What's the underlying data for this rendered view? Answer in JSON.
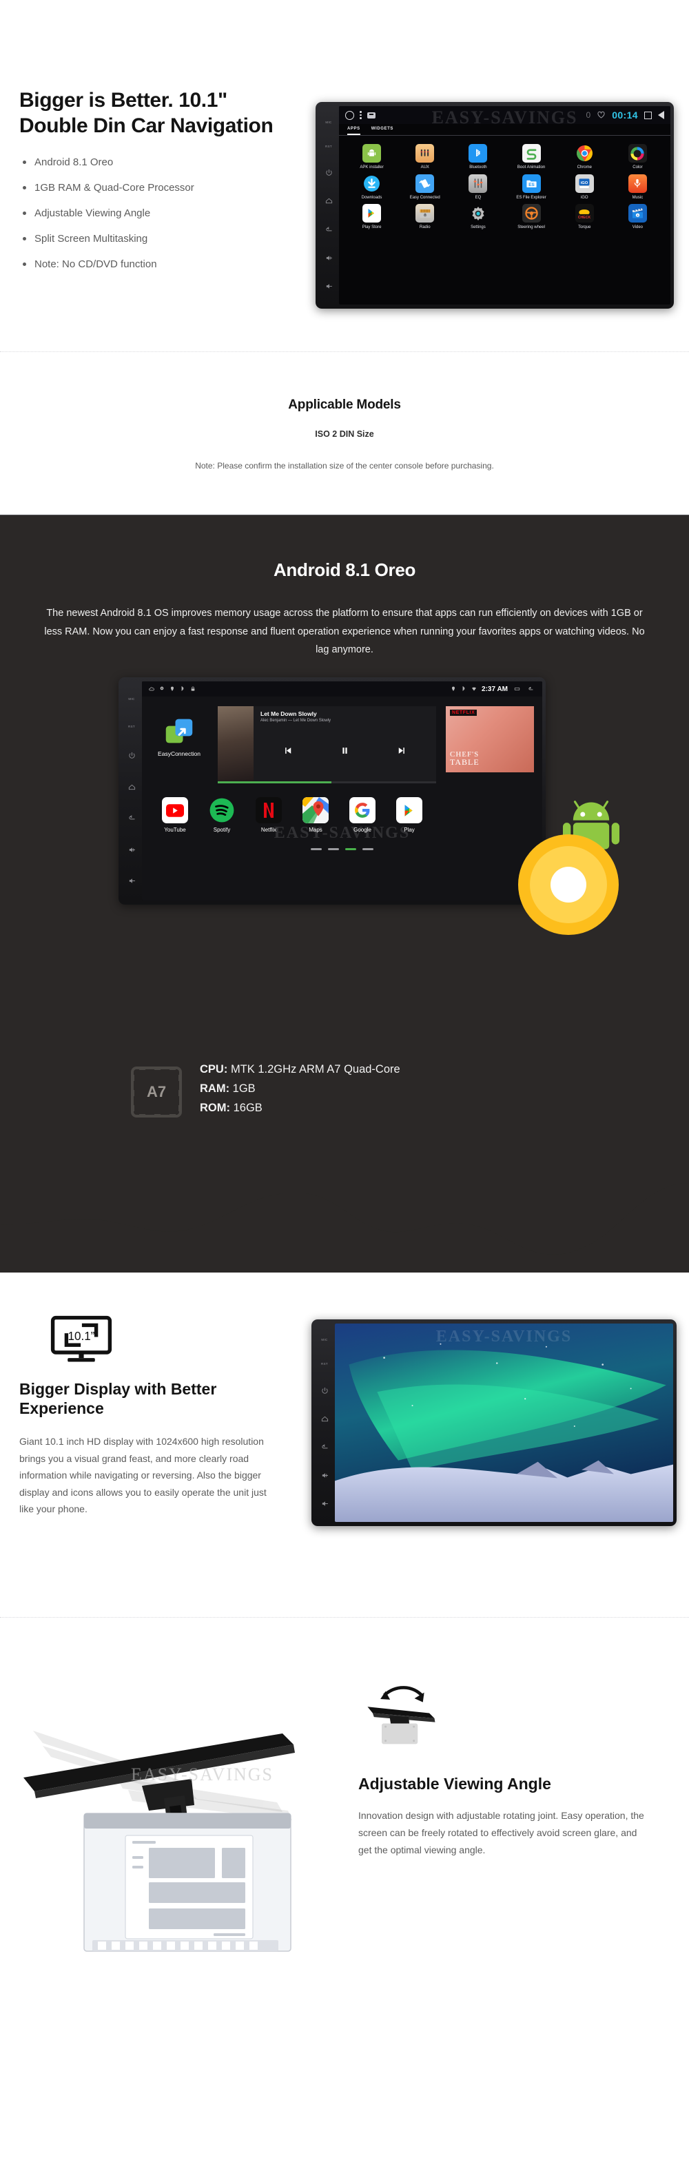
{
  "hero": {
    "title_line1": "Bigger is Better. 10.1\"",
    "title_line2": "Double Din Car Navigation",
    "features": [
      "Android 8.1 Oreo",
      "1GB RAM & Quad-Core Processor",
      "Adjustable Viewing Angle",
      "Split Screen Multitasking",
      "Note: No CD/DVD function"
    ],
    "device": {
      "watermark": "EASY-SAVINGS",
      "rail": [
        "MIC",
        "RST"
      ],
      "statusbar": {
        "badge_count": "0",
        "clock": "00:14"
      },
      "tabs": [
        {
          "label": "APPS",
          "active": true
        },
        {
          "label": "WIDGETS",
          "active": false
        }
      ],
      "apps": [
        {
          "label": "APK installer",
          "icon": "android-robot-icon"
        },
        {
          "label": "AUX",
          "icon": "aux-jacks-icon"
        },
        {
          "label": "Bluetooth",
          "icon": "bluetooth-icon"
        },
        {
          "label": "Boot Animation",
          "icon": "boot-animation-icon"
        },
        {
          "label": "Chrome",
          "icon": "chrome-icon"
        },
        {
          "label": "Color",
          "icon": "color-wheel-icon"
        },
        {
          "label": "Downloads",
          "icon": "download-arrow-icon"
        },
        {
          "label": "Easy Connected",
          "icon": "easy-connected-icon"
        },
        {
          "label": "EQ",
          "icon": "equalizer-icon"
        },
        {
          "label": "ES File Explorer",
          "icon": "es-file-explorer-icon"
        },
        {
          "label": "iGO",
          "icon": "igo-navigation-icon"
        },
        {
          "label": "Music",
          "icon": "music-mic-icon"
        },
        {
          "label": "Play Store",
          "icon": "play-store-icon"
        },
        {
          "label": "Radio",
          "icon": "radio-icon"
        },
        {
          "label": "Settings",
          "icon": "gear-icon"
        },
        {
          "label": "Steering wheel",
          "icon": "steering-wheel-icon"
        },
        {
          "label": "Torque",
          "icon": "torque-obd-icon"
        },
        {
          "label": "Video",
          "icon": "video-clapper-icon"
        }
      ]
    }
  },
  "models": {
    "heading": "Applicable Models",
    "subheading": "ISO 2 DIN Size",
    "note": "Note: Please confirm the installation size of the center console before purchasing."
  },
  "android": {
    "heading": "Android 8.1 Oreo",
    "body": "The newest Android 8.1 OS improves memory usage across the platform to ensure that apps can run efficiently on devices with 1GB or less RAM. Now you can enjoy a fast response and fluent operation experience when running your favorites apps or watching videos. No lag anymore.",
    "home": {
      "watermark": "EASY-SAVINGS",
      "statusbar": {
        "clock": "2:37 AM"
      },
      "shortcut": {
        "label": "EasyConnection",
        "icon": "easy-connection-icon"
      },
      "player": {
        "track_title": "Let Me Down Slowly",
        "track_artist": "Alec Benjamin — Let Me Down Slowly",
        "prev_icon": "skip-previous-icon",
        "pause_icon": "pause-icon",
        "next_icon": "skip-next-icon"
      },
      "netflix_card": {
        "brand": "NETFLIX",
        "title_line1": "CHEF'S",
        "title_line2": "TABLE"
      },
      "dock": [
        {
          "label": "YouTube",
          "icon": "youtube-icon"
        },
        {
          "label": "Spotify",
          "icon": "spotify-icon"
        },
        {
          "label": "Netflix",
          "icon": "netflix-icon"
        },
        {
          "label": "Maps",
          "icon": "google-maps-icon"
        },
        {
          "label": "Google",
          "icon": "google-icon"
        },
        {
          "label": "Play",
          "icon": "play-store-icon"
        }
      ],
      "page_count": 4,
      "active_page": 3
    },
    "oreo_logo": "android-oreo-logo",
    "specs": {
      "chip_label": "A7",
      "cpu_key": "CPU:",
      "cpu_value": "MTK 1.2GHz ARM A7 Quad-Core",
      "ram_key": "RAM:",
      "ram_value": "1GB",
      "rom_key": "ROM:",
      "rom_value": "16GB"
    }
  },
  "bigger_display": {
    "icon_label": "10.1”",
    "icon_name": "monitor-size-icon",
    "heading": "Bigger Display with Better Experience",
    "body": "Giant 10.1 inch HD display with 1024x600 high resolution brings you a visual grand feast, and more clearly road information while navigating or reversing. Also the bigger display and icons allows you to easily operate the unit just like your phone.",
    "device_watermark": "EASY-SAVINGS"
  },
  "adjustable": {
    "icon_name": "rotating-screen-icon",
    "heading": "Adjustable Viewing Angle",
    "body": "Innovation design with adjustable rotating joint. Easy operation, the screen can be freely rotated to effectively avoid screen glare, and get the optimal viewing angle.",
    "diagram_watermark": "EASY-SAVINGS"
  },
  "colors": {
    "dark_bg": "#2b2827",
    "accent_green": "#49b24b",
    "oreo_orange": "#fdbe1c",
    "clock_cyan": "#31c5e8"
  }
}
